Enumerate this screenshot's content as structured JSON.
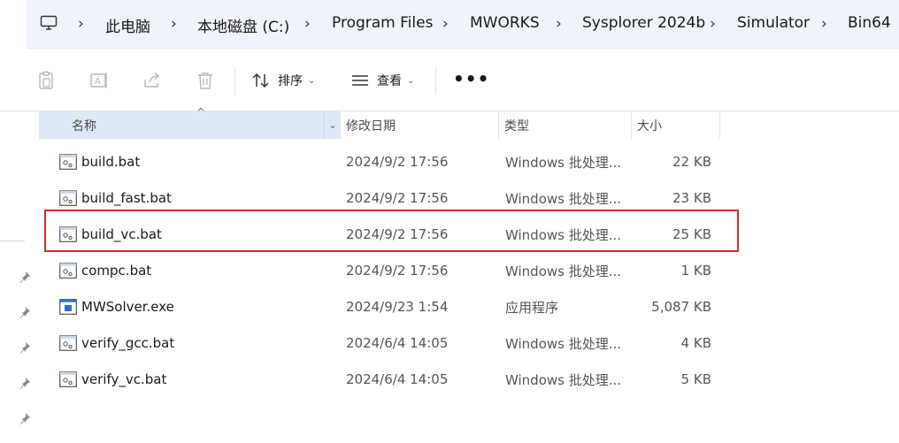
{
  "address_bar": {
    "crumbs": [
      "此电脑",
      "本地磁盘 (C:)",
      "Program Files",
      "MWORKS",
      "Sysplorer 2024b",
      "Simulator",
      "Bin64"
    ]
  },
  "toolbar": {
    "sort_label": "排序",
    "view_label": "查看",
    "more_label": "•••"
  },
  "columns": {
    "name": "名称",
    "date": "修改日期",
    "type": "类型",
    "size": "大小"
  },
  "files": [
    {
      "name": "build.bat",
      "date": "2024/9/2 17:56",
      "type": "Windows 批处理...",
      "size": "22 KB",
      "icon": "batch-file-icon"
    },
    {
      "name": "build_fast.bat",
      "date": "2024/9/2 17:56",
      "type": "Windows 批处理...",
      "size": "23 KB",
      "icon": "batch-file-icon"
    },
    {
      "name": "build_vc.bat",
      "date": "2024/9/2 17:56",
      "type": "Windows 批处理...",
      "size": "25 KB",
      "icon": "batch-file-icon"
    },
    {
      "name": "compc.bat",
      "date": "2024/9/2 17:56",
      "type": "Windows 批处理...",
      "size": "1 KB",
      "icon": "batch-file-icon"
    },
    {
      "name": "MWSolver.exe",
      "date": "2024/9/23 1:54",
      "type": "应用程序",
      "size": "5,087 KB",
      "icon": "exe-file-icon"
    },
    {
      "name": "verify_gcc.bat",
      "date": "2024/6/4 14:05",
      "type": "Windows 批处理...",
      "size": "4 KB",
      "icon": "batch-file-icon"
    },
    {
      "name": "verify_vc.bat",
      "date": "2024/6/4 14:05",
      "type": "Windows 批处理...",
      "size": "5 KB",
      "icon": "batch-file-icon"
    }
  ],
  "colors": {
    "highlight": "#d32d2d",
    "header_selected": "#dde9f7",
    "address_bg": "#f0f3f9"
  }
}
